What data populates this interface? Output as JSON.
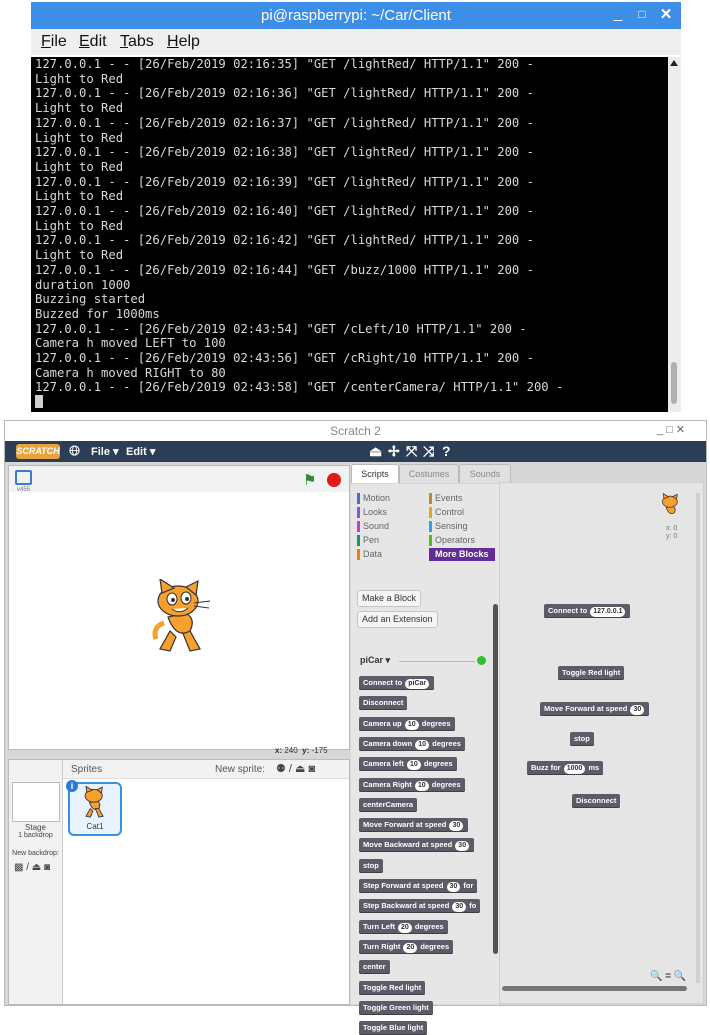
{
  "terminal": {
    "title": "pi@raspberrypi: ~/Car/Client",
    "controls": {
      "minimize": "_",
      "maximize": "□",
      "close": "✕"
    },
    "menu": [
      {
        "key": "F",
        "rest": "ile"
      },
      {
        "key": "E",
        "rest": "dit"
      },
      {
        "key": "T",
        "rest": "abs"
      },
      {
        "key": "H",
        "rest": "elp"
      }
    ],
    "lines": [
      "127.0.0.1 - - [26/Feb/2019 02:16:35] \"GET /lightRed/ HTTP/1.1\" 200 -",
      "Light to Red",
      "127.0.0.1 - - [26/Feb/2019 02:16:36] \"GET /lightRed/ HTTP/1.1\" 200 -",
      "Light to Red",
      "127.0.0.1 - - [26/Feb/2019 02:16:37] \"GET /lightRed/ HTTP/1.1\" 200 -",
      "Light to Red",
      "127.0.0.1 - - [26/Feb/2019 02:16:38] \"GET /lightRed/ HTTP/1.1\" 200 -",
      "Light to Red",
      "127.0.0.1 - - [26/Feb/2019 02:16:39] \"GET /lightRed/ HTTP/1.1\" 200 -",
      "Light to Red",
      "127.0.0.1 - - [26/Feb/2019 02:16:40] \"GET /lightRed/ HTTP/1.1\" 200 -",
      "Light to Red",
      "127.0.0.1 - - [26/Feb/2019 02:16:42] \"GET /lightRed/ HTTP/1.1\" 200 -",
      "Light to Red",
      "127.0.0.1 - - [26/Feb/2019 02:16:44] \"GET /buzz/1000 HTTP/1.1\" 200 -",
      "duration 1000",
      "Buzzing started",
      "Buzzed for 1000ms",
      "127.0.0.1 - - [26/Feb/2019 02:43:54] \"GET /cLeft/10 HTTP/1.1\" 200 -",
      "Camera h moved LEFT to 100",
      "127.0.0.1 - - [26/Feb/2019 02:43:56] \"GET /cRight/10 HTTP/1.1\" 200 -",
      "Camera h moved RIGHT to 80",
      "127.0.0.1 - - [26/Feb/2019 02:43:58] \"GET /centerCamera/ HTTP/1.1\" 200 -"
    ]
  },
  "scratch": {
    "title": "Scratch 2",
    "window_controls": "_  □  ✕",
    "logo": "SCRATCH",
    "menu": {
      "file": "File ▾",
      "edit": "Edit ▾"
    },
    "toolbar_icons": [
      "duplicate-icon",
      "delete-icon",
      "grow-icon",
      "shrink-icon",
      "help-icon"
    ],
    "stage": {
      "version": "v455",
      "mouse_x_label": "x:",
      "mouse_x": "240",
      "mouse_y_label": "y:",
      "mouse_y": "-175"
    },
    "sprites_panel": {
      "title": "Sprites",
      "new_sprite_label": "New sprite:",
      "stage_label": "Stage",
      "stage_backdrops": "1 backdrop",
      "new_backdrop_label": "New backdrop:",
      "sprite_name": "Cat1",
      "info_icon": "i"
    },
    "tabs": [
      "Scripts",
      "Costumes",
      "Sounds"
    ],
    "categories": [
      {
        "name": "Motion",
        "color": "#4a6cd4"
      },
      {
        "name": "Looks",
        "color": "#8a55d7"
      },
      {
        "name": "Sound",
        "color": "#bb42c3"
      },
      {
        "name": "Pen",
        "color": "#0e9a6c"
      },
      {
        "name": "Data",
        "color": "#ee7d16"
      },
      {
        "name": "Events",
        "color": "#c88330"
      },
      {
        "name": "Control",
        "color": "#e1a91a"
      },
      {
        "name": "Sensing",
        "color": "#2ca5e2"
      },
      {
        "name": "Operators",
        "color": "#5cb712"
      },
      {
        "name": "More Blocks",
        "color": "#632d99"
      }
    ],
    "palette": {
      "make_block": "Make a Block",
      "add_extension": "Add an Extension",
      "extension_name": "piCar ▾",
      "blocks": [
        {
          "pre": "Connect to",
          "slot": "piCar",
          "post": ""
        },
        {
          "pre": "Disconnect",
          "slot": "",
          "post": ""
        },
        {
          "pre": "Camera up",
          "slot": "10",
          "post": "degrees"
        },
        {
          "pre": "Camera down",
          "slot": "10",
          "post": "degrees"
        },
        {
          "pre": "Camera left",
          "slot": "10",
          "post": "degrees"
        },
        {
          "pre": "Camera Right",
          "slot": "10",
          "post": "degrees"
        },
        {
          "pre": "centerCamera",
          "slot": "",
          "post": ""
        },
        {
          "pre": "Move Forward at speed",
          "slot": "30",
          "post": ""
        },
        {
          "pre": "Move Backward at speed",
          "slot": "30",
          "post": ""
        },
        {
          "pre": "stop",
          "slot": "",
          "post": ""
        },
        {
          "pre": "Step Forward at speed",
          "slot": "30",
          "post": "for"
        },
        {
          "pre": "Step Backward at speed",
          "slot": "30",
          "post": "fo"
        },
        {
          "pre": "Turn Left",
          "slot": "20",
          "post": "degrees"
        },
        {
          "pre": "Turn Right",
          "slot": "20",
          "post": "degrees"
        },
        {
          "pre": "center",
          "slot": "",
          "post": ""
        },
        {
          "pre": "Toggle Red light",
          "slot": "",
          "post": ""
        },
        {
          "pre": "Toggle Green light",
          "slot": "",
          "post": ""
        },
        {
          "pre": "Toggle Blue light",
          "slot": "",
          "post": ""
        }
      ]
    },
    "scripts_area": {
      "sprite_x": "x: 0",
      "sprite_y": "y: 0",
      "zoom": "🔍 = 🔍",
      "blocks": [
        {
          "pre": "Connect to",
          "slot": "127.0.0.1",
          "post": ""
        },
        {
          "pre": "Toggle Red light",
          "slot": "",
          "post": ""
        },
        {
          "pre": "Move Forward at speed",
          "slot": "30",
          "post": ""
        },
        {
          "pre": "stop",
          "slot": "",
          "post": ""
        },
        {
          "pre": "Buzz for",
          "slot": "1000",
          "post": "ms"
        },
        {
          "pre": "Disconnect",
          "slot": "",
          "post": ""
        }
      ]
    }
  }
}
